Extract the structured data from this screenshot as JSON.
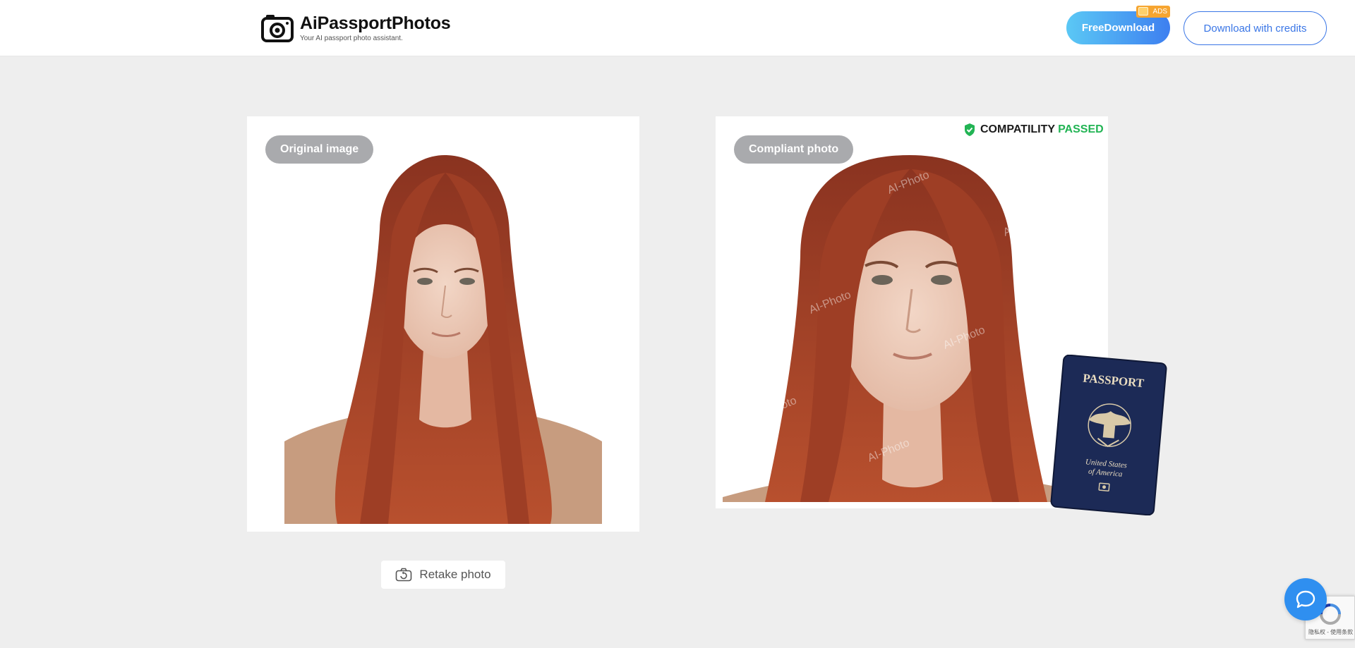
{
  "header": {
    "brand_name": "AiPassportPhotos",
    "tagline": "Your AI passport photo assistant.",
    "free_download_label": "FreeDownload",
    "ads_label": "ADS",
    "download_credits_label": "Download with credits"
  },
  "original_card": {
    "label": "Original image"
  },
  "compliant_card": {
    "label": "Compliant photo",
    "compatibility_label": "COMPATILITY",
    "compatibility_status": "PASSED",
    "watermark": "AI-Photo"
  },
  "passport": {
    "title": "PASSPORT",
    "country_line1": "United States",
    "country_line2": "of America"
  },
  "actions": {
    "retake_label": "Retake photo"
  },
  "recaptcha": {
    "text": "隐私权 - 使用条款"
  },
  "colors": {
    "accent_blue": "#3a76e6",
    "passed_green": "#22b454",
    "ads_orange": "#f6a531",
    "chat_blue": "#2f8ff0",
    "passport_navy": "#1c2a56"
  },
  "icons": {
    "logo": "camera-logo-icon",
    "compat": "shield-check-icon",
    "retake": "camera-retake-icon",
    "chat": "chat-bubble-icon",
    "captcha": "recaptcha-icon"
  }
}
